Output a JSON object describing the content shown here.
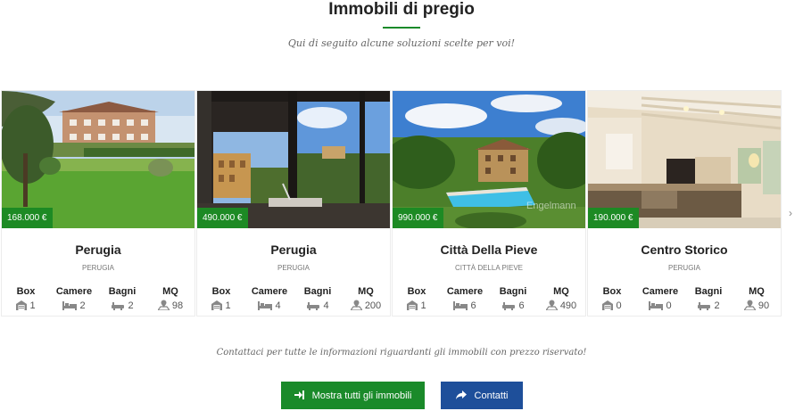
{
  "section": {
    "title": "Immobili di pregio",
    "subtitle": "Qui di seguito alcune soluzioni scelte per voi!"
  },
  "feature_labels": {
    "box": "Box",
    "camere": "Camere",
    "bagni": "Bagni",
    "mq": "MQ"
  },
  "properties": [
    {
      "price": "168.000 €",
      "name": "Perugia",
      "town": "PERUGIA",
      "box": "1",
      "camere": "2",
      "bagni": "2",
      "mq": "98"
    },
    {
      "price": "490.000 €",
      "name": "Perugia",
      "town": "PERUGIA",
      "box": "1",
      "camere": "4",
      "bagni": "4",
      "mq": "200"
    },
    {
      "price": "990.000 €",
      "name": "Città Della Pieve",
      "town": "CITTÀ DELLA PIEVE",
      "box": "1",
      "camere": "6",
      "bagni": "6",
      "mq": "490"
    },
    {
      "price": "190.000 €",
      "name": "Centro Storico",
      "town": "PERUGIA",
      "box": "0",
      "camere": "0",
      "bagni": "2",
      "mq": "90"
    }
  ],
  "icons": {
    "box": "garage-icon",
    "camere": "bed-icon",
    "bagni": "bathtub-icon",
    "mq": "area-map-icon",
    "next": "chevron-right-icon",
    "all": "sign-in-icon",
    "contact": "share-arrow-icon"
  },
  "contact_note": "Contattaci per tutte le informazioni riguardanti gli immobili con prezzo riservato!",
  "buttons": {
    "all_label": "Mostra tutti gli immobili",
    "contact_label": "Contatti"
  },
  "colors": {
    "accent_green": "#1a8a2a",
    "price_badge": "#1d8a24",
    "contact_blue": "#1e4f9a"
  }
}
